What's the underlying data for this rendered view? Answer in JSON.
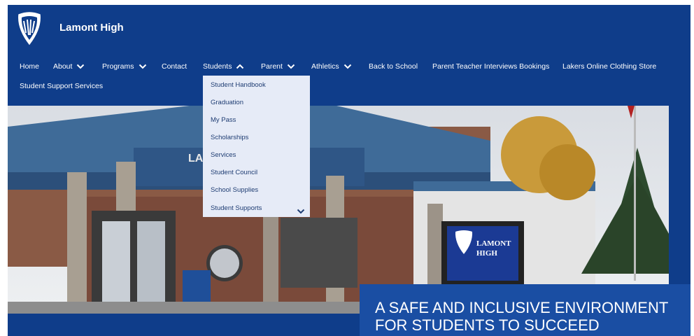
{
  "site": {
    "title": "Lamont High",
    "logo_icon": "lamont-high-crest"
  },
  "nav": {
    "items": [
      {
        "label": "Home"
      },
      {
        "label": "About",
        "icon": "chevron-down-icon"
      },
      {
        "label": "Programs",
        "icon": "chevron-down-icon"
      },
      {
        "label": "Contact"
      },
      {
        "label": "Students",
        "icon": "chevron-up-icon"
      },
      {
        "label": "Parent",
        "icon": "chevron-down-icon"
      },
      {
        "label": "Athletics",
        "icon": "chevron-down-icon"
      },
      {
        "label": "Back to School"
      },
      {
        "label": "Parent Teacher Interviews Bookings"
      },
      {
        "label": "Lakers Online Clothing Store"
      },
      {
        "label": "Student Support Services"
      }
    ]
  },
  "students_menu": {
    "items": [
      {
        "label": "Student Handbook"
      },
      {
        "label": "Graduation"
      },
      {
        "label": "My Pass"
      },
      {
        "label": "Scholarships"
      },
      {
        "label": "Services"
      },
      {
        "label": "Student Council"
      },
      {
        "label": "School Supplies"
      },
      {
        "label": "Student Supports",
        "icon": "chevron-down-icon"
      }
    ]
  },
  "hero": {
    "tagline": "A SAFE AND INCLUSIVE ENVIRONMENT FOR STUDENTS TO SUCCEED",
    "sign_text_1": "LAMONT",
    "sign_text_2": "HIGH",
    "building_letters": "LA"
  },
  "colors": {
    "header_bg": "#0f3d8a",
    "dropdown_bg": "#e6ebf7",
    "tagline_bg": "#1a4ea3"
  }
}
